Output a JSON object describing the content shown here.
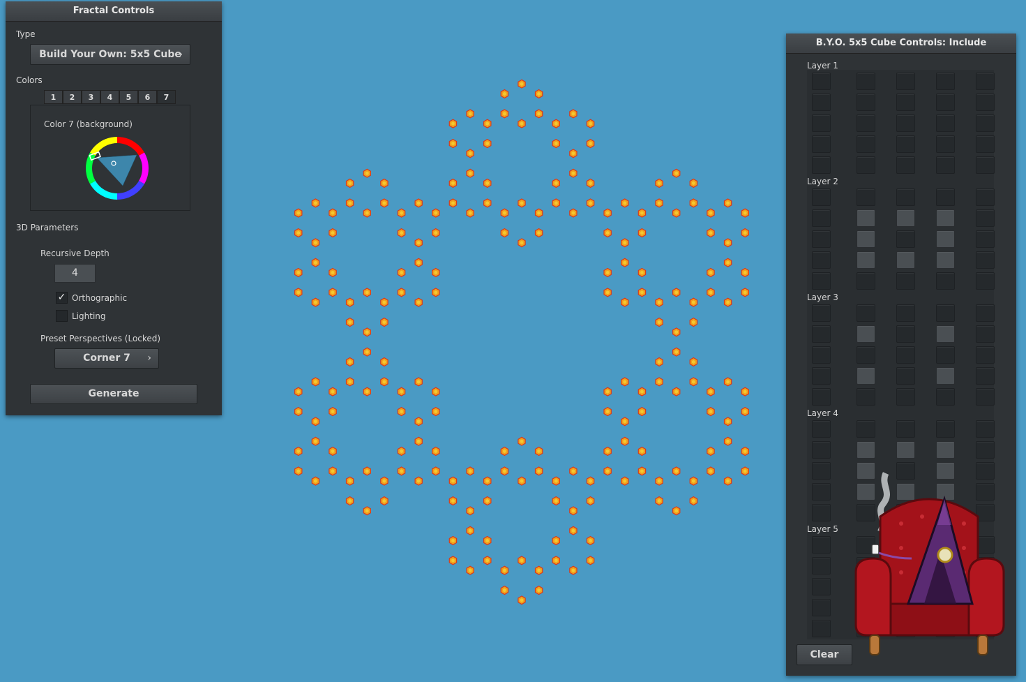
{
  "left_panel": {
    "title": "Fractal Controls",
    "type_label": "Type",
    "type_value": "Build Your Own: 5x5 Cube",
    "colors_label": "Colors",
    "color_tabs": [
      "1",
      "2",
      "3",
      "4",
      "5",
      "6",
      "7"
    ],
    "active_color_tab": "7",
    "color_title": "Color 7 (background)",
    "params_label": "3D Parameters",
    "depth_label": "Recursive Depth",
    "depth_value": "4",
    "orthographic_label": "Orthographic",
    "orthographic_checked": true,
    "lighting_label": "Lighting",
    "lighting_checked": false,
    "preset_label": "Preset Perspectives (Locked)",
    "preset_value": "Corner 7",
    "generate_label": "Generate",
    "arrow_icon": "›"
  },
  "right_panel": {
    "title": "B.Y.O. 5x5 Cube Controls: Include",
    "layers": [
      {
        "label": "Layer 1",
        "rows": [
          [
            0,
            0,
            0,
            0,
            0
          ],
          [
            0,
            0,
            0,
            0,
            0
          ],
          [
            0,
            0,
            0,
            0,
            0
          ],
          [
            0,
            0,
            0,
            0,
            0
          ],
          [
            0,
            0,
            0,
            0,
            0
          ]
        ]
      },
      {
        "label": "Layer 2",
        "rows": [
          [
            0,
            0,
            0,
            0,
            0
          ],
          [
            0,
            1,
            1,
            1,
            0
          ],
          [
            0,
            1,
            0,
            1,
            0
          ],
          [
            0,
            1,
            1,
            1,
            0
          ],
          [
            0,
            0,
            0,
            0,
            0
          ]
        ]
      },
      {
        "label": "Layer 3",
        "rows": [
          [
            0,
            0,
            0,
            0,
            0
          ],
          [
            0,
            1,
            0,
            1,
            0
          ],
          [
            0,
            0,
            0,
            0,
            0
          ],
          [
            0,
            1,
            0,
            1,
            0
          ],
          [
            0,
            0,
            0,
            0,
            0
          ]
        ]
      },
      {
        "label": "Layer 4",
        "rows": [
          [
            0,
            0,
            0,
            0,
            0
          ],
          [
            0,
            1,
            1,
            1,
            0
          ],
          [
            0,
            1,
            0,
            1,
            0
          ],
          [
            0,
            1,
            1,
            1,
            0
          ],
          [
            0,
            0,
            0,
            0,
            0
          ]
        ]
      },
      {
        "label": "Layer 5",
        "rows": [
          [
            0,
            0,
            0,
            0,
            0
          ],
          [
            0,
            0,
            0,
            0,
            0
          ],
          [
            0,
            0,
            0,
            0,
            0
          ],
          [
            0,
            0,
            0,
            0,
            0
          ],
          [
            0,
            0,
            0,
            0,
            0
          ]
        ]
      }
    ],
    "clear_label": "Clear"
  },
  "colors": {
    "background": "#4a9ac4",
    "fractal_orange": "#f2a11c",
    "fractal_red": "#d93a1a",
    "fractal_yellow": "#f7d83a"
  }
}
